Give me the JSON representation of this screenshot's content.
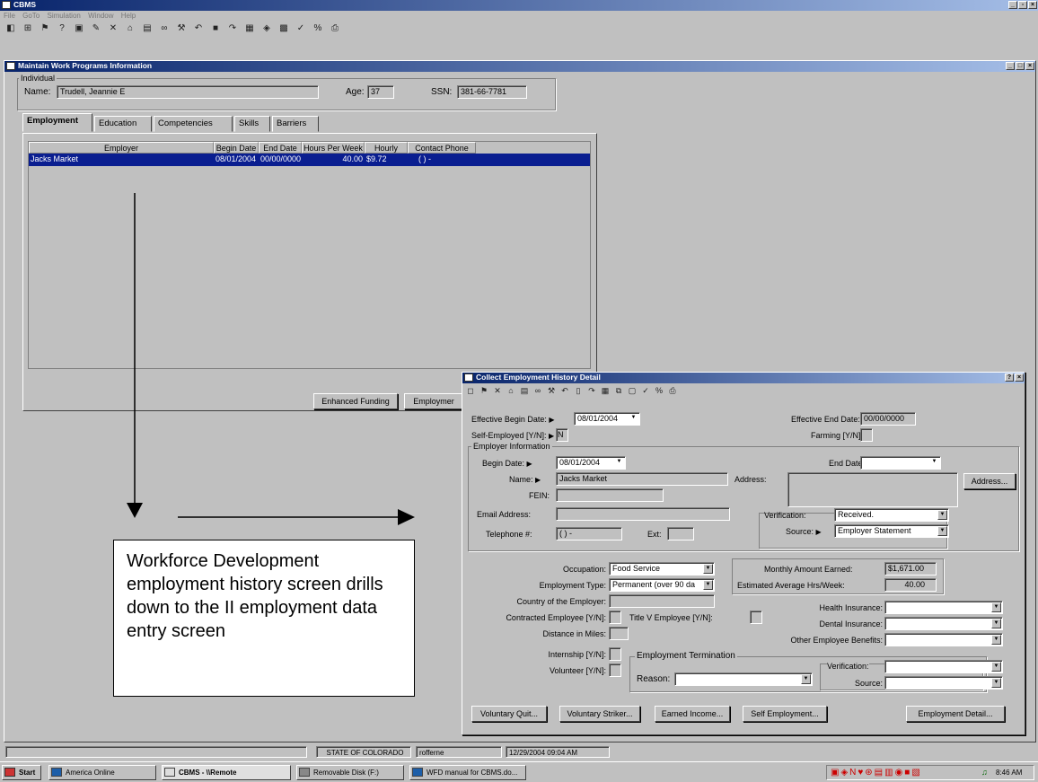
{
  "app": {
    "title": "CBMS",
    "menu": [
      "File",
      "GoTo",
      "Simulation",
      "Window",
      "Help"
    ]
  },
  "toolbar_icons": [
    "new-icon",
    "report-icon",
    "flag-icon",
    "help-icon",
    "doc-icon",
    "edit-icon",
    "delete-icon",
    "open-icon",
    "save-icon",
    "binoculars-icon",
    "tools-icon",
    "undo-icon",
    "stop-icon",
    "redo-icon",
    "grid-icon",
    "filter-icon",
    "disabled-icon",
    "check-icon",
    "percent-icon",
    "print-icon"
  ],
  "main_window": {
    "title": "Maintain Work Programs Information",
    "individual": {
      "group_label": "Individual",
      "name_label": "Name:",
      "name_value": "Trudell, Jeannie E",
      "age_label": "Age:",
      "age_value": "37",
      "ssn_label": "SSN:",
      "ssn_value": "381-66-7781"
    },
    "tabs": [
      "Employment",
      "Education",
      "Competencies",
      "Skills",
      "Barriers"
    ],
    "table": {
      "columns": [
        "Employer",
        "Begin Date",
        "End Date",
        "Hours Per Week",
        "Hourly Wage",
        "Contact Phone"
      ],
      "rows": [
        {
          "employer": "Jacks Market",
          "begin": "08/01/2004",
          "end": "00/00/0000",
          "hours": "40.00",
          "wage": "$9.72",
          "phone": "( ) -"
        }
      ]
    },
    "buttons": {
      "enhanced_funding": "Enhanced Funding",
      "employment": "Employmer"
    }
  },
  "detail_window": {
    "title": "Collect Employment History Detail",
    "effective_begin_label": "Effective Begin Date:",
    "effective_begin_value": "08/01/2004",
    "effective_end_label": "Effective End Date:",
    "effective_end_value": "00/00/0000",
    "self_employed_label": "Self-Employed [Y/N]:",
    "self_employed_value": "N",
    "farming_label": "Farming [Y/N]:",
    "farming_value": "",
    "employer_info": {
      "group_label": "Employer Information",
      "begin_label": "Begin Date:",
      "begin_value": "08/01/2004",
      "end_label": "End Date:",
      "end_value": "",
      "name_label": "Name:",
      "name_value": "Jacks Market",
      "address_label": "Address:",
      "address_button": "Address...",
      "fein_label": "FEIN:",
      "email_label": "Email Address:",
      "telephone_label": "Telephone #:",
      "telephone_value": "( ) -",
      "ext_label": "Ext:",
      "verification_label": "Verification:",
      "verification_value": "Received.",
      "source_label": "Source:",
      "source_value": "Employer Statement"
    },
    "occupation_label": "Occupation:",
    "occupation_value": "Food Service",
    "employment_type_label": "Employment Type:",
    "employment_type_value": "Permanent (over 90 da",
    "country_label": "Country of the Employer:",
    "contracted_label": "Contracted Employee [Y/N]:",
    "title_v_label": "Title V Employee [Y/N]:",
    "distance_label": "Distance in Miles:",
    "internship_label": "Internship [Y/N]:",
    "volunteer_label": "Volunteer [Y/N]:",
    "monthly_label": "Monthly Amount Earned:",
    "monthly_value": "$1,671.00",
    "avg_hours_label": "Estimated Average Hrs/Week:",
    "avg_hours_value": "40.00",
    "health_label": "Health Insurance:",
    "dental_label": "Dental Insurance:",
    "other_benefits_label": "Other Employee Benefits:",
    "termination": {
      "group_label": "Employment Termination",
      "reason_label": "Reason:",
      "verification_label": "Verification:",
      "source_label": "Source:"
    },
    "buttons": [
      "Voluntary Quit...",
      "Voluntary Striker...",
      "Earned Income...",
      "Self Employment...",
      "Employment Detail..."
    ]
  },
  "annotation": "Workforce Development employment history screen drills down to the II employment data entry screen",
  "statusbar": {
    "state": "STATE OF COLORADO",
    "user": "rofferne",
    "datetime": "12/29/2004 09:04 AM"
  },
  "taskbar": {
    "start": "Start",
    "items": [
      "America Online",
      "CBMS - \\\\Remote",
      "Removable Disk (F:)",
      "WFD manual for CBMS.do..."
    ],
    "clock": "8:46 AM"
  }
}
